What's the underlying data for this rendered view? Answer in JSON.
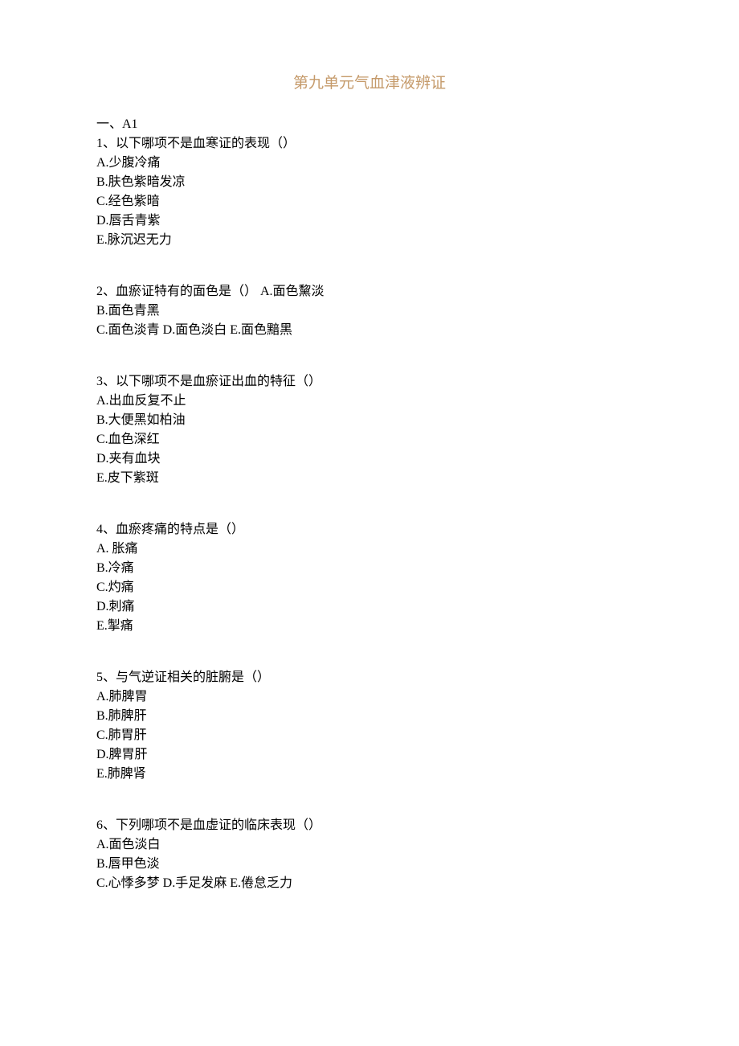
{
  "title": "第九单元气血津液辨证",
  "section_header": "一、A1",
  "questions": [
    {
      "stem": "1、以下哪项不是血寒证的表现（）",
      "options": [
        "A.少腹冷痛",
        "B.肤色紫暗发凉",
        "C.经色紫暗",
        "D.唇舌青紫",
        "E.脉沉迟无力"
      ]
    },
    {
      "stem": "2、血瘀证特有的面色是（） A.面色黧淡",
      "options": [
        "B.面色青黑",
        "C.面色淡青 D.面色淡白 E.面色黯黑"
      ]
    },
    {
      "stem": "3、以下哪项不是血瘀证出血的特征（）",
      "options": [
        "A.出血反复不止",
        "B.大便黑如柏油",
        "C.血色深红",
        "D.夹有血块",
        "E.皮下紫斑"
      ]
    },
    {
      "stem": "4、血瘀疼痛的特点是（）",
      "options": [
        "A. 胀痛",
        "B.冷痛",
        "C.灼痛",
        "D.刺痛",
        "E.掣痛"
      ]
    },
    {
      "stem": "5、与气逆证相关的脏腑是（）",
      "options": [
        "A.肺脾胃",
        "B.肺脾肝",
        "C.肺胃肝",
        "D.脾胃肝",
        "E.肺脾肾"
      ]
    },
    {
      "stem": "6、下列哪项不是血虚证的临床表现（）",
      "options": [
        "A.面色淡白",
        "B.唇甲色淡",
        "C.心悸多梦 D.手足发麻 E.倦怠乏力"
      ]
    }
  ]
}
